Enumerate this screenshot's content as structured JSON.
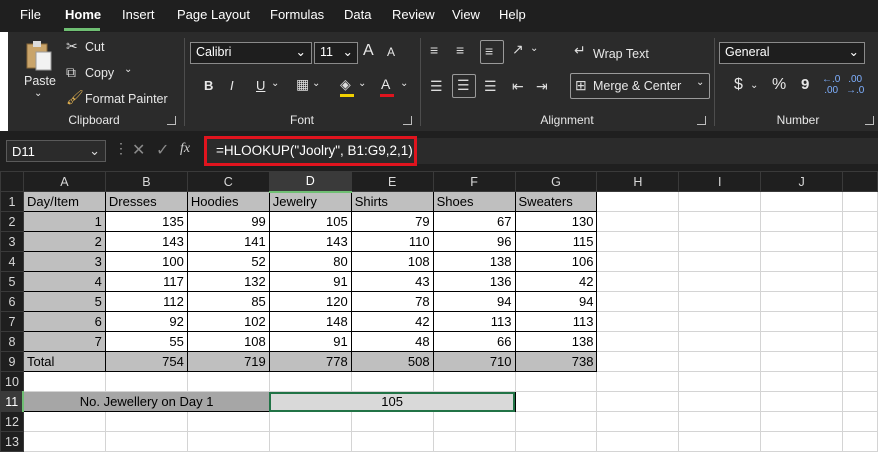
{
  "menu": {
    "items": [
      "File",
      "Home",
      "Insert",
      "Page Layout",
      "Formulas",
      "Data",
      "Review",
      "View",
      "Help"
    ],
    "active": "Home"
  },
  "ribbon": {
    "clipboard": {
      "paste": "Paste",
      "cut": "Cut",
      "copy": "Copy",
      "format_painter": "Format Painter",
      "label": "Clipboard"
    },
    "font": {
      "name": "Calibri",
      "size": "11",
      "bold": "B",
      "italic": "I",
      "underline": "U",
      "font_color": "A",
      "grow": "A",
      "shrink": "A",
      "label": "Font"
    },
    "alignment": {
      "wrap_text": "Wrap Text",
      "merge_center": "Merge & Center",
      "label": "Alignment"
    },
    "number": {
      "format": "General",
      "currency": "$",
      "percent": "%",
      "comma": "9",
      "label": "Number"
    }
  },
  "formula_bar": {
    "name_box": "D11",
    "fx": "fx",
    "formula": "=HLOOKUP(\"Joolry\", B1:G9,2,1)"
  },
  "sheet": {
    "columns": [
      "A",
      "B",
      "C",
      "D",
      "E",
      "F",
      "G",
      "H",
      "I",
      "J"
    ],
    "selected_col": "D",
    "selected_row": "11",
    "header": [
      "Day/Item",
      "Dresses",
      "Hoodies",
      "Jewelry",
      "Shirts",
      "Shoes",
      "Sweaters"
    ],
    "rows": [
      [
        "1",
        "135",
        "99",
        "105",
        "79",
        "67",
        "130"
      ],
      [
        "2",
        "143",
        "141",
        "143",
        "110",
        "96",
        "115"
      ],
      [
        "3",
        "100",
        "52",
        "80",
        "108",
        "138",
        "106"
      ],
      [
        "4",
        "117",
        "132",
        "91",
        "43",
        "136",
        "42"
      ],
      [
        "5",
        "112",
        "85",
        "120",
        "78",
        "94",
        "94"
      ],
      [
        "6",
        "92",
        "102",
        "148",
        "42",
        "113",
        "113"
      ],
      [
        "7",
        "55",
        "108",
        "91",
        "48",
        "66",
        "138"
      ]
    ],
    "total": [
      "Total",
      "754",
      "719",
      "778",
      "508",
      "710",
      "738"
    ],
    "row11_label": "No. Jewellery on Day 1",
    "row11_value": "105",
    "row_numbers": [
      "1",
      "2",
      "3",
      "4",
      "5",
      "6",
      "7",
      "8",
      "9",
      "10",
      "11",
      "12",
      "13"
    ]
  }
}
